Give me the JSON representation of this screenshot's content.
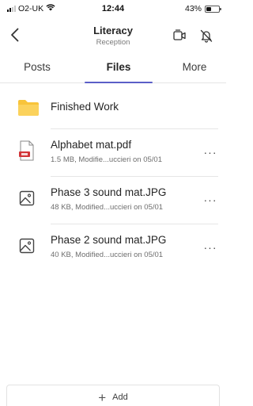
{
  "status_bar": {
    "carrier": "O2-UK",
    "time": "12:44",
    "battery_percent": "43%",
    "battery_level": 0.43,
    "wifi_icon": "wifi-icon"
  },
  "header": {
    "title": "Literacy",
    "subtitle": "Reception",
    "back_icon": "chevron-left-icon",
    "meet_icon": "video-call-icon",
    "notifications_icon": "bell-off-icon"
  },
  "tabs": [
    {
      "label": "Posts",
      "active": false
    },
    {
      "label": "Files",
      "active": true
    },
    {
      "label": "More",
      "active": false
    }
  ],
  "files": [
    {
      "name": "Finished Work",
      "meta": "",
      "icon": "folder-icon"
    },
    {
      "name": "Alphabet mat.pdf",
      "meta": "1.5 MB, Modifie...uccieri on 05/01",
      "icon": "pdf-file-icon"
    },
    {
      "name": "Phase 3 sound mat.JPG",
      "meta": "48 KB, Modified...uccieri on 05/01",
      "icon": "image-file-icon"
    },
    {
      "name": "Phase 2 sound mat.JPG",
      "meta": "40 KB, Modified...uccieri on 05/01",
      "icon": "image-file-icon"
    }
  ],
  "more_label": "···",
  "add_bar": {
    "label": "Add",
    "icon": "plus-icon"
  },
  "colors": {
    "accent": "#5b5fc7",
    "folder": "#f8c43a",
    "pdf": "#d13438"
  }
}
